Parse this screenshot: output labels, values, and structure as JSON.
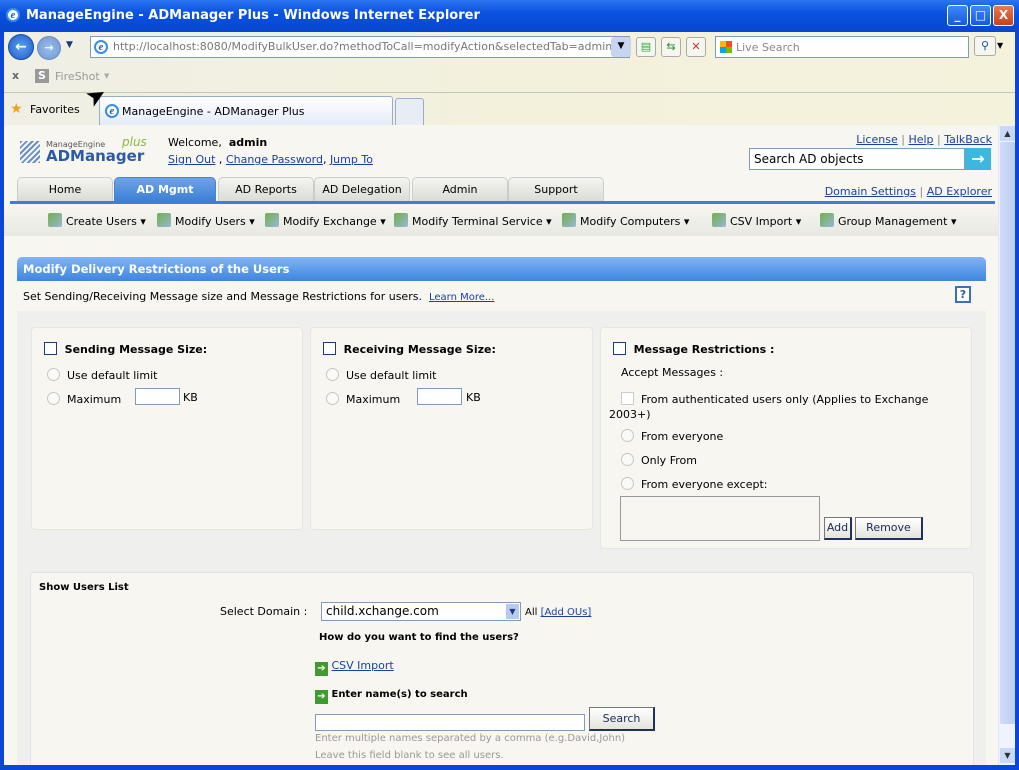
{
  "window": {
    "title": "ManageEngine - ADManager Plus - Windows Internet Explorer",
    "min": "_",
    "max": "□",
    "close": "X"
  },
  "browser": {
    "url": "http://localhost:8080/ModifyBulkUser.do?methodToCall=modifyAction&selectedTab=admin&reportId=1",
    "search_placeholder": "Live Search",
    "toolbar_close": "x",
    "fireshot": "FireShot",
    "favorites": "Favorites",
    "tab_title": "ManageEngine - ADManager Plus"
  },
  "header": {
    "logo_small": "ManageEngine",
    "logo_big": "ADManager",
    "logo_plus": "plus",
    "welcome": "Welcome,",
    "user": "admin",
    "sign_out": "Sign Out",
    "change_password": "Change Password",
    "jump_to": "Jump To",
    "license": "License",
    "help": "Help",
    "talkback": "TalkBack",
    "search_placeholder": "Search AD objects",
    "domain_settings": "Domain Settings",
    "ad_explorer": "AD Explorer"
  },
  "tabs": [
    "Home",
    "AD Mgmt",
    "AD Reports",
    "AD Delegation",
    "Admin",
    "Support"
  ],
  "subnav": [
    "Create Users",
    "Modify Users",
    "Modify Exchange",
    "Modify Terminal Service",
    "Modify Computers",
    "CSV Import",
    "Group Management"
  ],
  "panel": {
    "title": "Modify Delivery Restrictions of the Users",
    "description": "Set Sending/Receiving Message size and Message Restrictions for users.",
    "learn_more": "Learn More...",
    "help": "?"
  },
  "sending": {
    "label": "Sending Message Size:",
    "default": "Use default limit",
    "maximum": "Maximum",
    "unit": "KB",
    "value": ""
  },
  "receiving": {
    "label": "Receiving Message Size:",
    "default": "Use default limit",
    "maximum": "Maximum",
    "unit": "KB",
    "value": ""
  },
  "restrictions": {
    "label": "Message Restrictions :",
    "accept": "Accept Messages :",
    "authenticated": "From authenticated users only (Applies to Exchange 2003+)",
    "everyone": "From everyone",
    "only_from": "Only From",
    "except": "From everyone except:",
    "add": "Add",
    "remove": "Remove"
  },
  "users": {
    "title": "Show Users List",
    "domain_label": "Select Domain :",
    "domain": "child.xchange.com",
    "all": "All",
    "add_ous": "[Add OUs]",
    "question": "How do you want to find the users?",
    "csv": "CSV Import",
    "enter": "Enter name(s) to search",
    "search": "Search",
    "hint1": "Enter multiple names separated by a comma (e.g.David,John)",
    "hint2": "Leave this field blank to see all users."
  }
}
